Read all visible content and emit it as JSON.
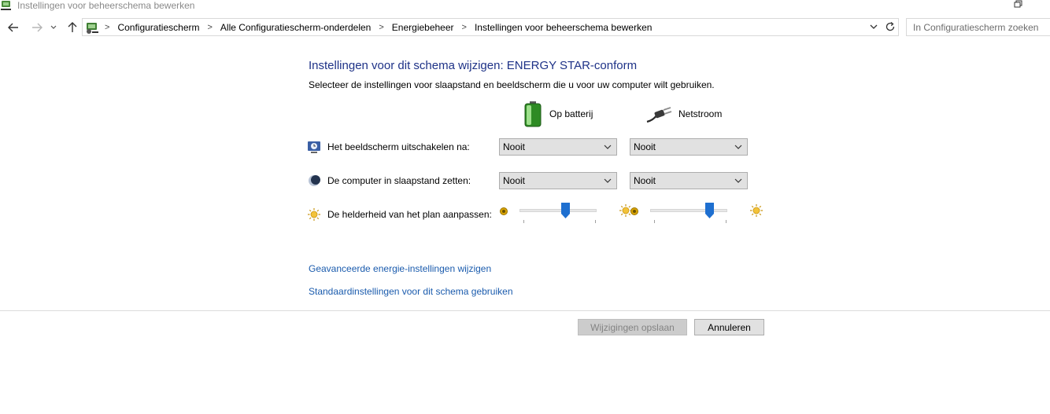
{
  "window": {
    "title": "Instellingen voor beheerschema bewerken",
    "app_icon": "power-options-icon",
    "restore_icon": "restore-window-icon"
  },
  "nav": {
    "back_icon": "arrow-left-icon",
    "forward_icon": "arrow-right-icon",
    "recent_icon": "chevron-down-icon",
    "up_icon": "arrow-up-icon"
  },
  "address": {
    "crumbs": [
      "Configuratiescherm",
      "Alle Configuratiescherm-onderdelen",
      "Energiebeheer",
      "Instellingen voor beheerschema bewerken"
    ],
    "separator": ">"
  },
  "search": {
    "placeholder": "In Configuratiescherm zoeken"
  },
  "main": {
    "heading": "Instellingen voor dit schema wijzigen: ENERGY STAR-conform",
    "subheading": "Selecteer de instellingen voor slaapstand en beeldscherm die u voor uw computer wilt gebruiken.",
    "columns": {
      "battery": "Op batterij",
      "plugged": "Netstroom"
    },
    "rows": {
      "display": {
        "label": "Het beeldscherm uitschakelen na:",
        "battery_value": "Nooit",
        "plugged_value": "Nooit"
      },
      "sleep": {
        "label": "De computer in slaapstand zetten:",
        "battery_value": "Nooit",
        "plugged_value": "Nooit"
      },
      "brightness": {
        "label": "De helderheid van het plan aanpassen:",
        "battery_level": 0.6,
        "plugged_level": 0.77
      }
    },
    "links": {
      "advanced": "Geavanceerde energie-instellingen wijzigen",
      "defaults": "Standaardinstellingen voor dit schema gebruiken"
    }
  },
  "footer": {
    "save_label": "Wijzigingen opslaan",
    "cancel_label": "Annuleren"
  },
  "colors": {
    "heading": "#1e3287",
    "link": "#1a5bad",
    "slider_thumb": "#1e6fd0"
  }
}
